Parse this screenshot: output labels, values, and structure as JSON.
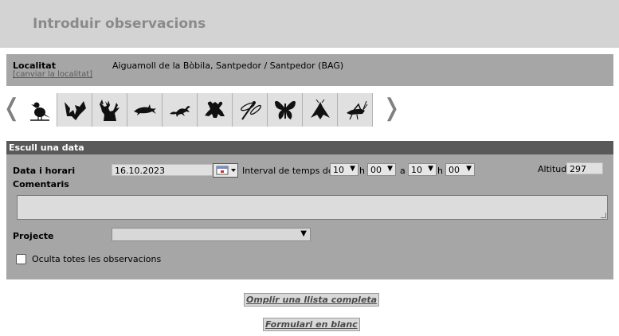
{
  "header": {
    "title": "Introduir observacions"
  },
  "location": {
    "label": "Localitat",
    "change_link": "[canviar la localitat]",
    "value": "Aiguamoll de la Bòbila, Santpedor / Santpedor (BAG)"
  },
  "taxon_bar": {
    "prev_arrow": "❬",
    "next_arrow": "❭",
    "groups": [
      {
        "icon": "bird-icon"
      },
      {
        "icon": "bat-icon"
      },
      {
        "icon": "deer-icon"
      },
      {
        "icon": "dolphin-icon"
      },
      {
        "icon": "lizard-icon"
      },
      {
        "icon": "frog-icon"
      },
      {
        "icon": "dragonfly-icon"
      },
      {
        "icon": "butterfly-icon"
      },
      {
        "icon": "moth-icon"
      },
      {
        "icon": "grasshopper-icon"
      }
    ]
  },
  "form": {
    "section_title": "Escull una data",
    "date_label": "Data i horari",
    "date_value": "16.10.2023",
    "interval_label": "Interval de temps de",
    "from_hour": "10",
    "from_min": "00",
    "h_sep": "h",
    "to_sep": "a",
    "to_hour": "10",
    "to_min": "00",
    "altitude_label": "Altitud",
    "altitude_value": "297",
    "comments_label": "Comentaris",
    "project_label": "Projecte",
    "project_value": "",
    "hide_label": "Oculta totes les observacions"
  },
  "actions": {
    "complete_list": "Omplir una llista completa",
    "blank_form": "Formulari en blanc"
  }
}
